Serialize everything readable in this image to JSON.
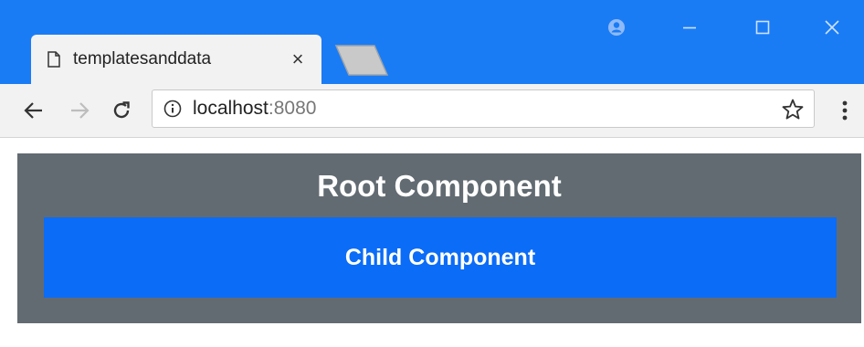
{
  "browser": {
    "tab": {
      "title": "templatesanddata",
      "close_label": "×"
    },
    "address": {
      "host": "localhost",
      "port": ":8080"
    }
  },
  "icons": {
    "tab": "document-icon",
    "new_tab": "new-tab-icon",
    "profile": "profile-icon",
    "minimize": "minimize-icon",
    "maximize": "maximize-icon",
    "close": "close-icon",
    "back": "back-arrow-icon",
    "forward": "forward-arrow-icon",
    "reload": "reload-icon",
    "info": "info-icon",
    "bookmark": "star-icon",
    "menu": "kebab-menu-icon"
  },
  "colors": {
    "titlebar": "#1a7cf5",
    "root_background": "#626b72",
    "child_background": "#0b6cf7",
    "text_on_components": "#ffffff"
  },
  "page": {
    "root_component": {
      "title": "Root Component"
    },
    "child_component": {
      "title": "Child Component"
    }
  }
}
